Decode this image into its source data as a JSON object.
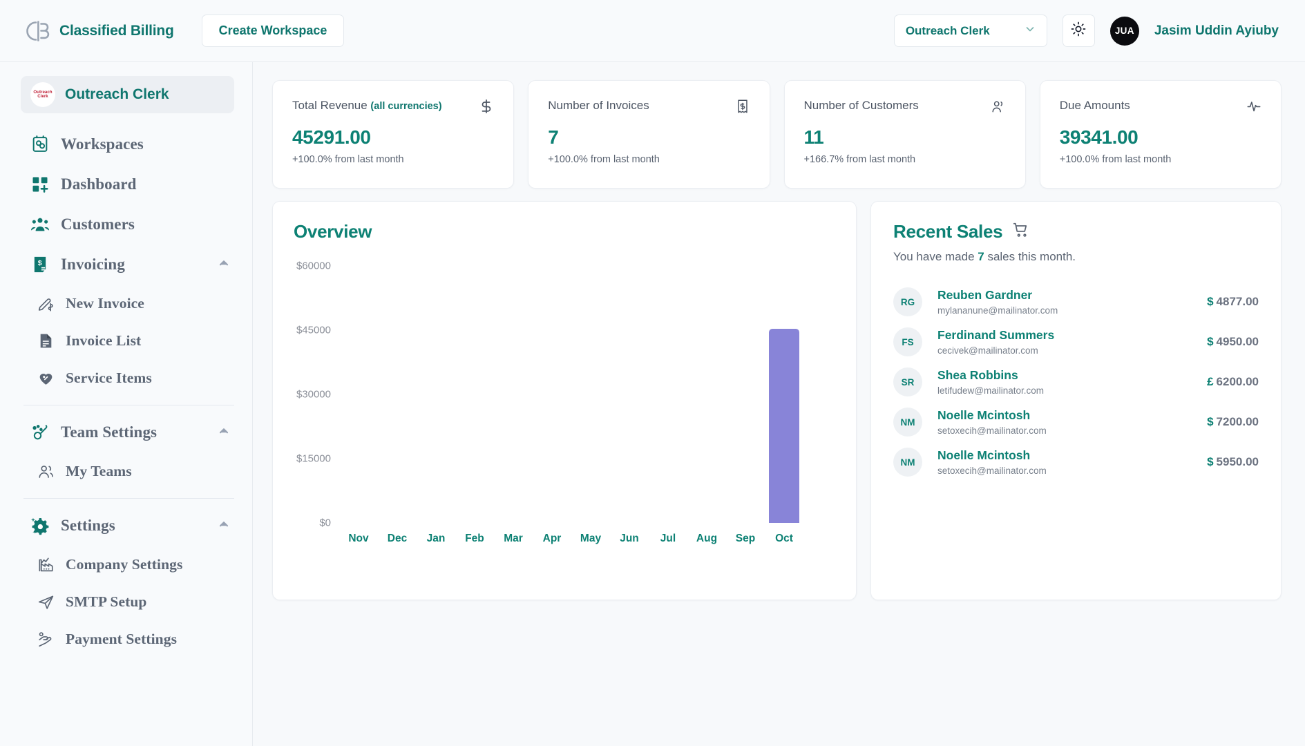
{
  "header": {
    "brand_name": "Classified Billing",
    "brand_logo_icon": "cb-logo-icon",
    "create_workspace_label": "Create Workspace",
    "workspace_select_value": "Outreach Clerk",
    "workspace_select_icon": "chevron-down-icon",
    "theme_toggle_icon": "sun-icon",
    "user_initials": "JUA",
    "user_name": "Jasim Uddin Ayiuby"
  },
  "sidebar": {
    "workspace": {
      "logo_line1": "Outreach",
      "logo_line2": "Clerk",
      "name": "Outreach Clerk"
    },
    "items": [
      {
        "label": "Workspaces",
        "icon": "workspaces-icon",
        "level": "top",
        "caret": ""
      },
      {
        "label": "Dashboard",
        "icon": "dashboard-icon",
        "level": "top",
        "caret": ""
      },
      {
        "label": "Customers",
        "icon": "customers-icon",
        "level": "top",
        "caret": ""
      },
      {
        "label": "Invoicing",
        "icon": "invoicing-icon",
        "level": "top",
        "caret": "chevron-up-icon"
      },
      {
        "label": "New Invoice",
        "icon": "new-invoice-icon",
        "level": "sub",
        "caret": ""
      },
      {
        "label": "Invoice List",
        "icon": "invoice-list-icon",
        "level": "sub",
        "caret": ""
      },
      {
        "label": "Service Items",
        "icon": "service-items-icon",
        "level": "sub",
        "caret": ""
      },
      {
        "label": "Team Settings",
        "icon": "team-settings-icon",
        "level": "top",
        "caret": "chevron-up-icon",
        "divider_before": true
      },
      {
        "label": "My Teams",
        "icon": "my-teams-icon",
        "level": "sub",
        "caret": ""
      },
      {
        "label": "Settings",
        "icon": "settings-gear-icon",
        "level": "top",
        "caret": "chevron-up-icon",
        "divider_before": true
      },
      {
        "label": "Company Settings",
        "icon": "company-settings-icon",
        "level": "sub",
        "caret": ""
      },
      {
        "label": "SMTP Setup",
        "icon": "smtp-setup-icon",
        "level": "sub",
        "caret": ""
      },
      {
        "label": "Payment Settings",
        "icon": "payment-settings-icon",
        "level": "sub",
        "caret": ""
      }
    ]
  },
  "stats": [
    {
      "title": "Total Revenue",
      "title_accent": "(all currencies)",
      "value": "45291.00",
      "sub": "+100.0% from last month",
      "icon": "dollar-sign-icon"
    },
    {
      "title": "Number of Invoices",
      "title_accent": "",
      "value": "7",
      "sub": "+100.0% from last month",
      "icon": "receipt-icon"
    },
    {
      "title": "Number of Customers",
      "title_accent": "",
      "value": "11",
      "sub": "+166.7% from last month",
      "icon": "users-icon"
    },
    {
      "title": "Due Amounts",
      "title_accent": "",
      "value": "39341.00",
      "sub": "+100.0% from last month",
      "icon": "activity-icon"
    }
  ],
  "overview": {
    "title": "Overview"
  },
  "chart_data": {
    "type": "bar",
    "title": "Overview",
    "xlabel": "",
    "ylabel": "",
    "categories": [
      "Nov",
      "Dec",
      "Jan",
      "Feb",
      "Mar",
      "Apr",
      "May",
      "Jun",
      "Jul",
      "Aug",
      "Sep",
      "Oct"
    ],
    "values": [
      0,
      0,
      0,
      0,
      0,
      0,
      0,
      0,
      0,
      0,
      0,
      45291
    ],
    "ylim": [
      0,
      60000
    ],
    "yticks": [
      0,
      15000,
      30000,
      45000,
      60000
    ],
    "ytick_labels": [
      "$0",
      "$15000",
      "$30000",
      "$45000",
      "$60000"
    ],
    "bar_color": "#8884d8",
    "grid": false,
    "legend": false
  },
  "recent_sales": {
    "title": "Recent Sales",
    "cart_icon": "shopping-cart-icon",
    "subtitle_prefix": "You have made ",
    "subtitle_count": "7",
    "subtitle_suffix": " sales this month.",
    "rows": [
      {
        "initials": "RG",
        "name": "Reuben Gardner",
        "email": "mylananune@mailinator.com",
        "currency": "$",
        "amount": "4877.00"
      },
      {
        "initials": "FS",
        "name": "Ferdinand Summers",
        "email": "cecivek@mailinator.com",
        "currency": "$",
        "amount": "4950.00"
      },
      {
        "initials": "SR",
        "name": "Shea Robbins",
        "email": "letifudew@mailinator.com",
        "currency": "£",
        "amount": "6200.00"
      },
      {
        "initials": "NM",
        "name": "Noelle Mcintosh",
        "email": "setoxecih@mailinator.com",
        "currency": "$",
        "amount": "7200.00"
      },
      {
        "initials": "NM",
        "name": "Noelle Mcintosh",
        "email": "setoxecih@mailinator.com",
        "currency": "$",
        "amount": "5950.00"
      }
    ]
  },
  "colors": {
    "accent": "#0d8174",
    "bar": "#8884d8",
    "page_bg": "#f7f9fb",
    "sidebar_bg": "#f8fafc"
  }
}
